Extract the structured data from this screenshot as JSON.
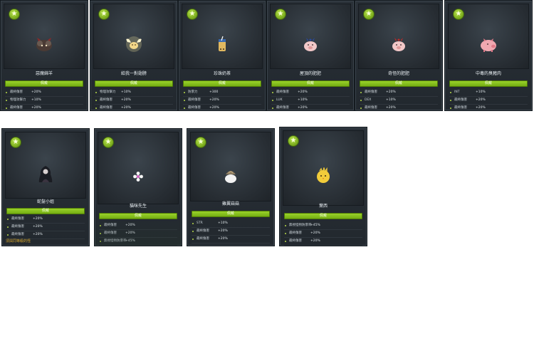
{
  "button_label": "佩戴",
  "cards": [
    {
      "name": "惡魔綿羊",
      "icon": "devil-sheep",
      "stats": [
        {
          "label": "最終傷害",
          "value": "+20%"
        },
        {
          "label": "物理攻擊力",
          "value": "+10%"
        },
        {
          "label": "最終傷害",
          "value": "+20%"
        }
      ]
    },
    {
      "name": "給我一對翅膀",
      "icon": "winged-fairy",
      "stats": [
        {
          "label": "物理攻擊力",
          "value": "+10%"
        },
        {
          "label": "最終傷害",
          "value": "+20%"
        },
        {
          "label": "最終傷害",
          "value": "+20%"
        }
      ]
    },
    {
      "name": "珍珠奶茶",
      "icon": "bubble-tea",
      "stats": [
        {
          "label": "防禦力",
          "value": "+300"
        },
        {
          "label": "最終傷害",
          "value": "+20%"
        },
        {
          "label": "最終傷害",
          "value": "+20%"
        }
      ]
    },
    {
      "name": "屋頂的肥肥",
      "icon": "pig-ribbon",
      "stats": [
        {
          "label": "最終傷害",
          "value": "+20%"
        },
        {
          "label": "LUK",
          "value": "+10%"
        },
        {
          "label": "最終傷害",
          "value": "+20%"
        }
      ]
    },
    {
      "name": "奇怪的肥肥",
      "icon": "pig-red-ribbon",
      "stats": [
        {
          "label": "最終傷害",
          "value": "+20%"
        },
        {
          "label": "DEX",
          "value": "+10%"
        },
        {
          "label": "最終傷害",
          "value": "+20%"
        }
      ]
    },
    {
      "name": "中毒的臭豬肉",
      "icon": "pink-pig",
      "stats": [
        {
          "label": "INT",
          "value": "+10%"
        },
        {
          "label": "最終傷害",
          "value": "+20%"
        },
        {
          "label": "最終傷害",
          "value": "+20%"
        }
      ]
    },
    {
      "name": "蛇髮小姐",
      "icon": "dark-lady",
      "stats": [
        {
          "label": "最終傷害",
          "value": "+20%"
        },
        {
          "label": "最終傷害",
          "value": "+20%"
        },
        {
          "label": "最終傷害",
          "value": "+20%"
        }
      ],
      "note": "須與同等級的怪"
    },
    {
      "name": "貓咪先生",
      "icon": "flower-cat",
      "stats": [
        {
          "label": "最終傷害",
          "value": "+20%"
        },
        {
          "label": "最終傷害",
          "value": "+20%"
        },
        {
          "label": "無視怪物防禦率",
          "value": "+45%"
        }
      ]
    },
    {
      "name": "雞翼菇菇",
      "icon": "mushroom-bag",
      "stats": [
        {
          "label": "STR",
          "value": "+10%"
        },
        {
          "label": "最終傷害",
          "value": "+20%"
        },
        {
          "label": "最終傷害",
          "value": "+20%"
        }
      ]
    },
    {
      "name": "葉西",
      "icon": "yellow-chick",
      "stats": [
        {
          "label": "無視怪物防禦率",
          "value": "+45%"
        },
        {
          "label": "最終傷害",
          "value": "+20%"
        },
        {
          "label": "最終傷害",
          "value": "+20%"
        }
      ]
    }
  ]
}
